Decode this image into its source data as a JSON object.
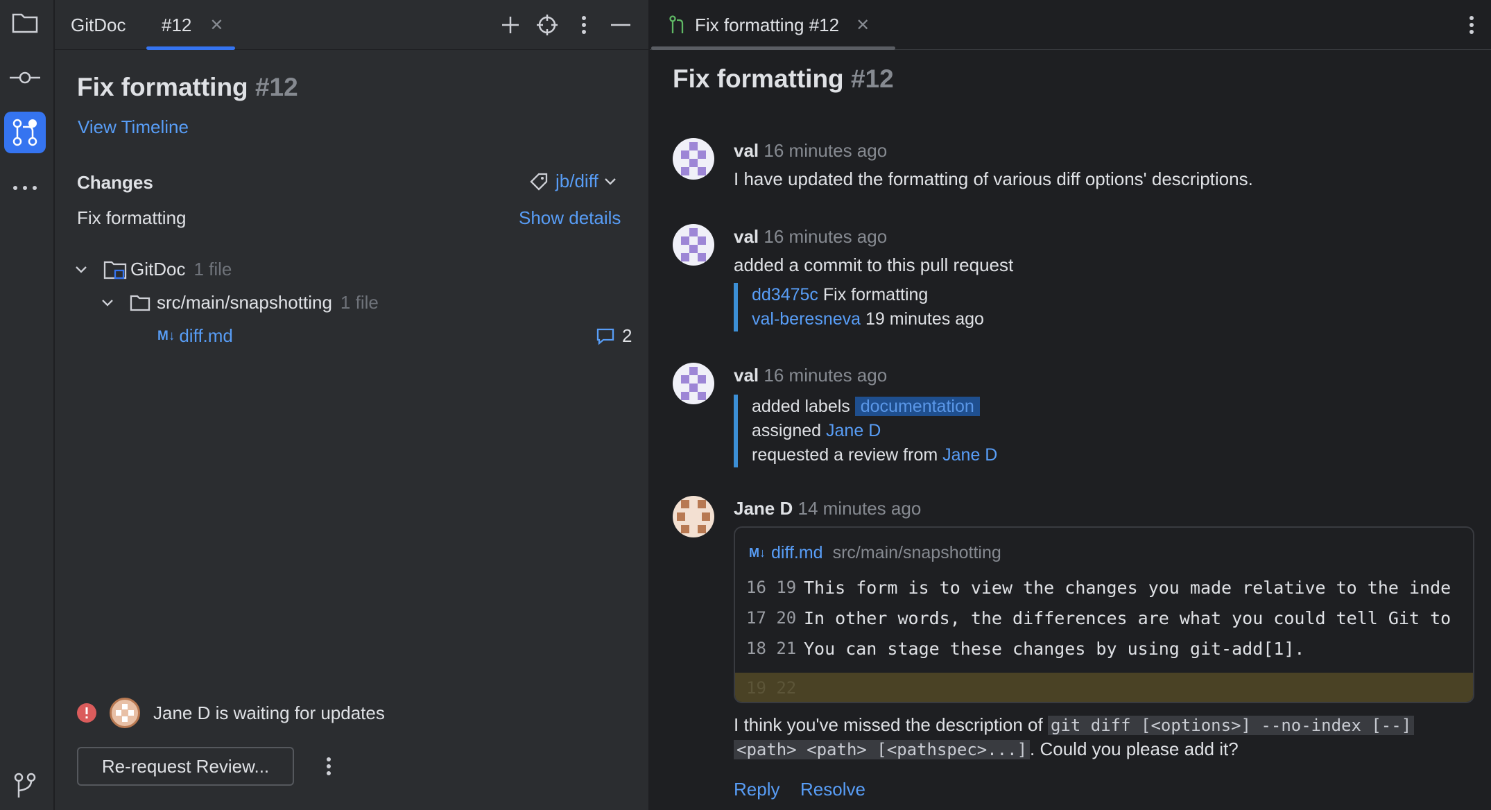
{
  "left_panel": {
    "tabs": [
      {
        "label": "GitDoc"
      },
      {
        "label": "#12"
      }
    ],
    "title": "Fix formatting",
    "title_number": "#12",
    "view_timeline": "View Timeline",
    "changes_header": "Changes",
    "branch": "jb/diff",
    "commit_message": "Fix formatting",
    "show_details": "Show details",
    "tree": {
      "root": {
        "name": "GitDoc",
        "count": "1 file"
      },
      "folder": {
        "name": "src/main/snapshotting",
        "count": "1 file"
      },
      "file": {
        "name": "diff.md",
        "comments": "2"
      }
    },
    "status_text": "Jane D is waiting for updates",
    "rerequest_button": "Re-request Review..."
  },
  "right_panel": {
    "tab_title": "Fix formatting #12",
    "title": "Fix formatting",
    "title_number": "#12",
    "events": [
      {
        "author": "val",
        "time": "16 minutes ago",
        "text": "I have updated the formatting of various diff options' descriptions."
      },
      {
        "author": "val",
        "time": "16 minutes ago",
        "text": "added a commit to this pull request",
        "commit_hash": "dd3475c",
        "commit_message": "Fix formatting",
        "commit_author": "val-beresneva",
        "commit_time": "19 minutes ago"
      },
      {
        "author": "val",
        "time": "16 minutes ago",
        "line1_prefix": "added labels",
        "label": "documentation",
        "line2_prefix": "assigned",
        "assignee": "Jane D",
        "line3_prefix": "requested a review from",
        "reviewer": "Jane D"
      },
      {
        "author": "Jane D",
        "time": "14 minutes ago"
      }
    ],
    "review": {
      "file": "diff.md",
      "path": "src/main/snapshotting",
      "lines": [
        {
          "old": "16",
          "new": "19",
          "text": "This form is to view the changes you made relative to the inde"
        },
        {
          "old": "17",
          "new": "20",
          "text": "In other words, the differences are what you could tell Git to"
        },
        {
          "old": "18",
          "new": "21",
          "text": "You can stage these changes by using git-add[1]."
        },
        {
          "old": "19",
          "new": "22",
          "text": ""
        }
      ],
      "comment_prefix": "I think you've missed the description of",
      "code1": "git diff [<options>] --no-index [--]",
      "code2": "<path> <path> [<pathspec>...]",
      "comment_suffix": ". Could you please add it?",
      "reply": "Reply",
      "resolve": "Resolve"
    }
  },
  "colors": {
    "accent": "#3574f0",
    "link": "#589df6",
    "error": "#db5c5c",
    "highlight_line": "#4a4225"
  }
}
